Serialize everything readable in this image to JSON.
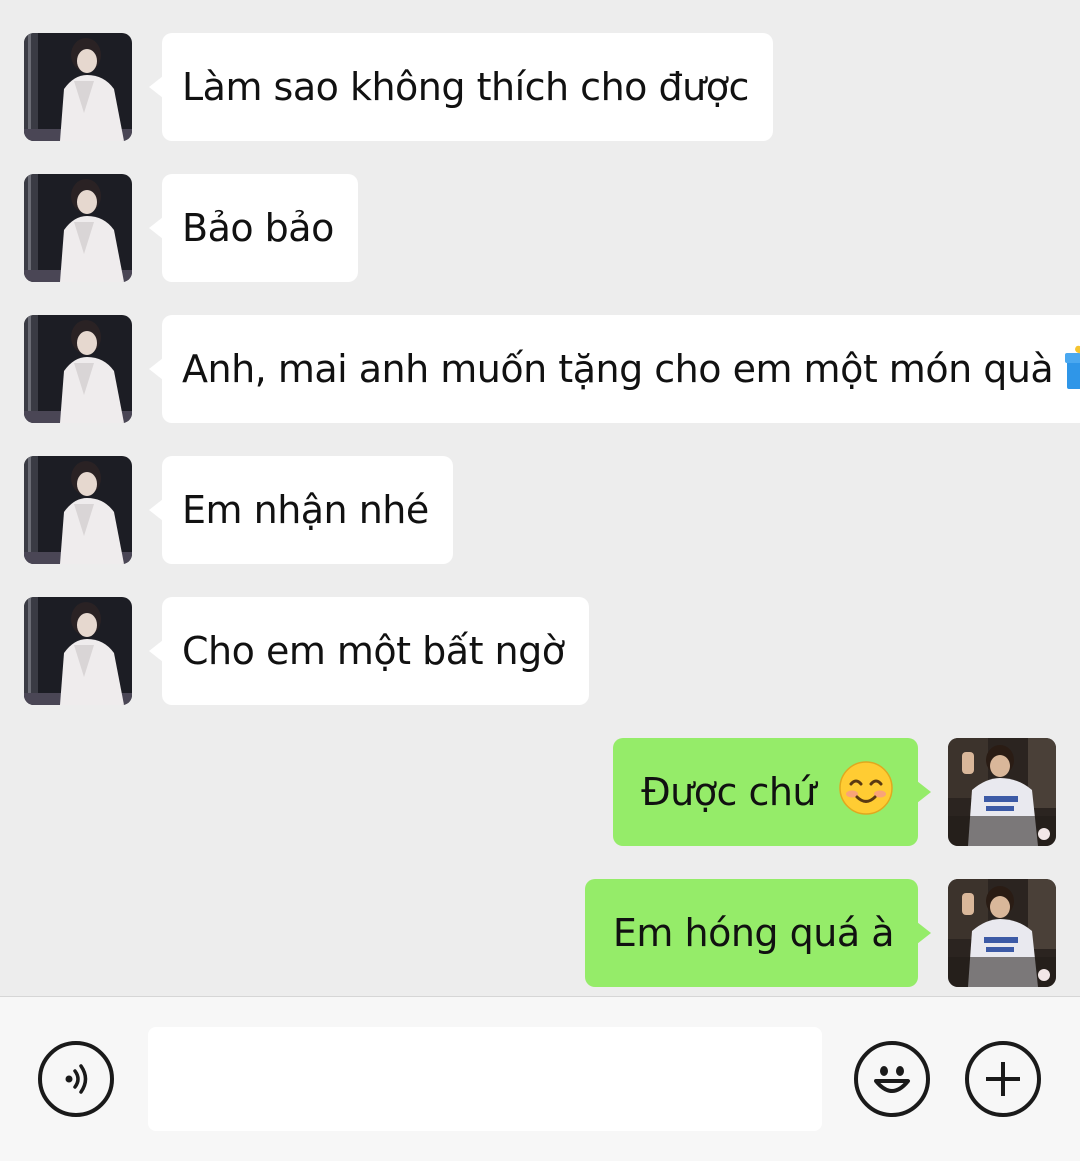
{
  "messages": [
    {
      "side": "incoming",
      "text": "Làm sao không thích cho được"
    },
    {
      "side": "incoming",
      "text": "Bảo bảo"
    },
    {
      "side": "incoming",
      "text": "Anh, mai anh muốn tặng cho em một món quà",
      "emoji": "gift-emoji"
    },
    {
      "side": "incoming",
      "text": "Em nhận nhé"
    },
    {
      "side": "incoming",
      "text": "Cho em một bất ngờ"
    },
    {
      "side": "outgoing",
      "text": "Được chứ",
      "emoji": "smiling-face-emoji"
    },
    {
      "side": "outgoing",
      "text": "Em hóng quá à"
    }
  ],
  "input_bar": {
    "voice_icon": "voice-icon",
    "message_value": "",
    "emoji_icon": "emoji-icon",
    "add_icon": "add-icon"
  },
  "colors": {
    "background": "#ededed",
    "incoming_bubble": "#ffffff",
    "outgoing_bubble": "#95ec69",
    "input_bar": "#f7f7f7"
  }
}
